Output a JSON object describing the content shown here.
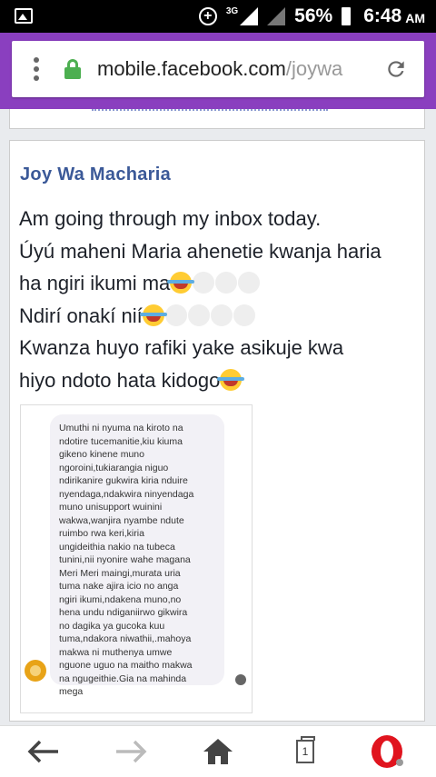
{
  "status_bar": {
    "network": "3G",
    "battery": "56%",
    "time": "6:48",
    "ampm": "AM"
  },
  "browser": {
    "url_domain": "mobile.facebook.com",
    "url_path": "/joywa",
    "brand_color": "#8a3fbf"
  },
  "post": {
    "author": "Joy Wa Macharia",
    "lines": [
      "Am going through my inbox today.",
      "Úyú maheni Maria ahenetie kwanja haria",
      "ha ngiri ikumi ma",
      "Ndirí onakí nií",
      "Kwanza huyo rafiki yake asikuje kwa",
      "hiyo ndoto hata kidogo"
    ],
    "image_text_lines": [
      "Umuthi ni nyuma na kiroto na",
      "ndotire tucemanitie,kiu kiuma",
      "gikeno kinene muno",
      "ngoroini,tukiarangia niguo",
      "ndirikanire gukwira kiria nduire",
      "nyendaga,ndakwira ninyendaga",
      "muno unisupport wuinini",
      "wakwa,wanjira nyambe ndute",
      "ruimbo rwa keri,kiria",
      "ungideithia nakio na tubeca",
      "tunini,nii nyonire wahe magana",
      "Meri Meri maingi,murata uria",
      "tuma nake ajira icio no anga",
      "ngiri ikumi,ndakena muno,no",
      "hena undu ndiganiirwo gikwira",
      "no dagika ya gucoka kuu",
      "tuma,ndakora niwathii,.mahoya",
      "makwa ni muthenya umwe",
      "nguone uguo na maitho makwa",
      "na ngugeithie.Gia na mahinda",
      "mega"
    ]
  },
  "bottom_nav": {
    "tab_count": "1",
    "opera_color": "#e0141e"
  }
}
